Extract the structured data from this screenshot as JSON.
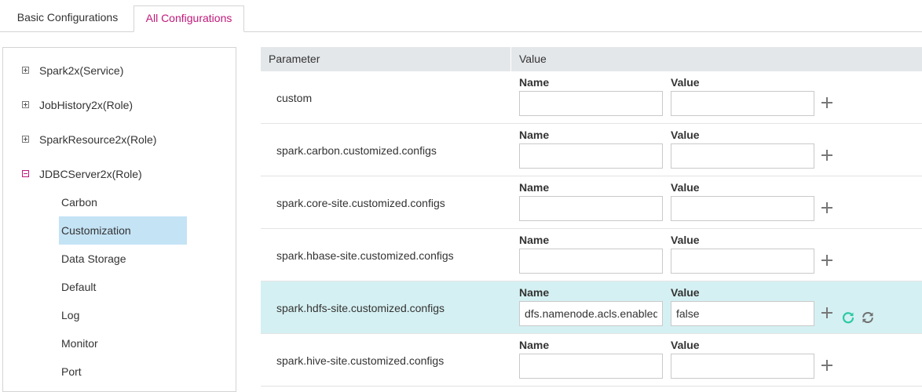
{
  "tabs": [
    {
      "label": "Basic Configurations",
      "active": false
    },
    {
      "label": "All Configurations",
      "active": true
    }
  ],
  "tree": {
    "nodes": [
      {
        "label": "Spark2x(Service)",
        "expanded": false
      },
      {
        "label": "JobHistory2x(Role)",
        "expanded": false
      },
      {
        "label": "SparkResource2x(Role)",
        "expanded": false
      },
      {
        "label": "JDBCServer2x(Role)",
        "expanded": true
      }
    ],
    "children": [
      "Carbon",
      "Customization",
      "Data Storage",
      "Default",
      "Log",
      "Monitor",
      "Port"
    ],
    "selected": "Customization"
  },
  "table": {
    "header": {
      "parameter": "Parameter",
      "value": "Value"
    },
    "name_label": "Name",
    "value_label": "Value",
    "rows": [
      {
        "param": "custom",
        "name": "",
        "value": ""
      },
      {
        "param": "spark.carbon.customized.configs",
        "name": "",
        "value": ""
      },
      {
        "param": "spark.core-site.customized.configs",
        "name": "",
        "value": ""
      },
      {
        "param": "spark.hbase-site.customized.configs",
        "name": "",
        "value": ""
      },
      {
        "param": "spark.hdfs-site.customized.configs",
        "name": "dfs.namenode.acls.enabled",
        "value": "false"
      },
      {
        "param": "spark.hive-site.customized.configs",
        "name": "",
        "value": ""
      }
    ]
  },
  "icons": {
    "add": "plus-icon",
    "restore": "restore-icon",
    "refresh": "refresh-icon"
  },
  "colors": {
    "accent": "#c0187a",
    "selected_bg": "#c4e3f5",
    "highlight_row": "#d5f0f2",
    "restore_icon": "#2bc9a4",
    "header_bg": "#e4e7ea"
  }
}
